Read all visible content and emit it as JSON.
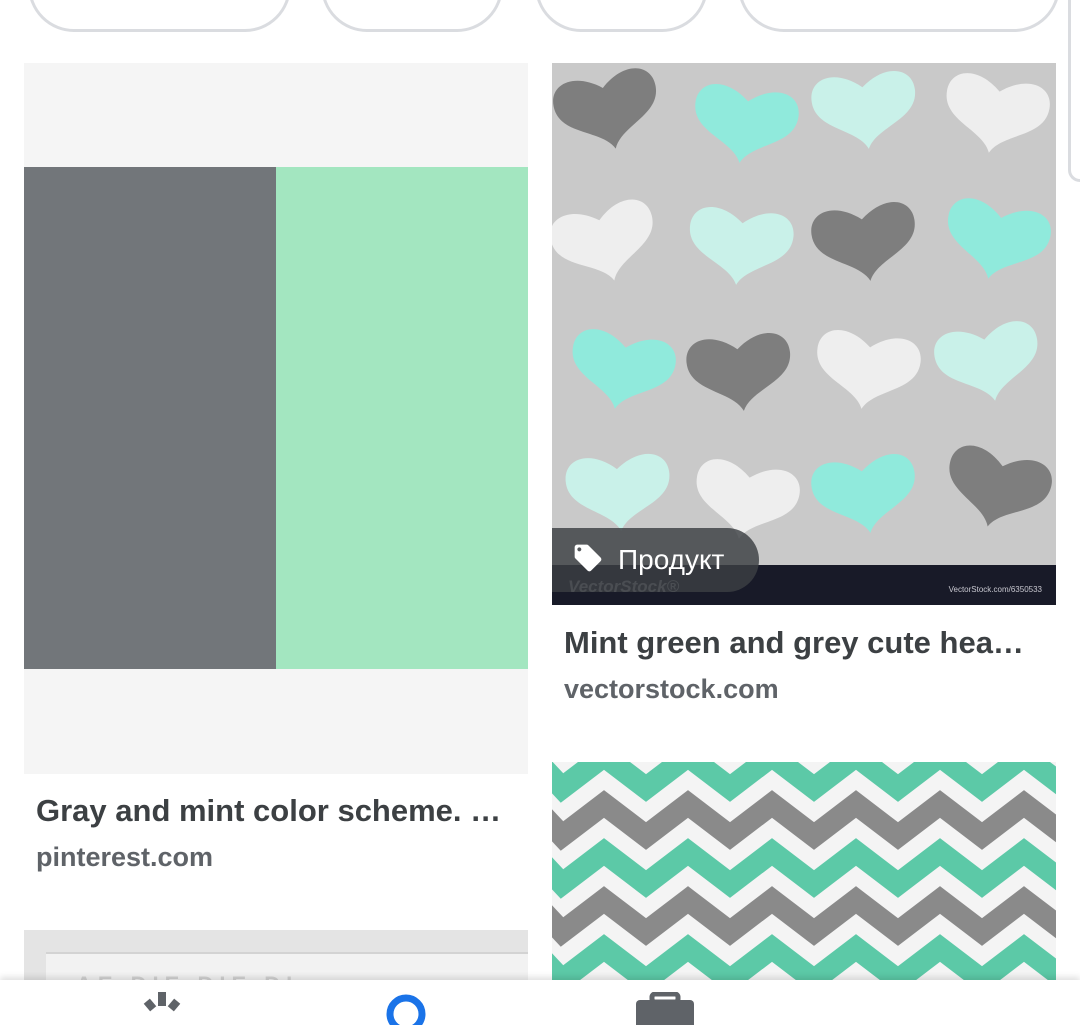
{
  "results": [
    {
      "title": "Gray and mint color scheme. …",
      "source": "pinterest.com",
      "colors": [
        "#72767a",
        "#a3e6c0"
      ]
    },
    {
      "title": "Mint green and grey cute hea…",
      "source": "vectorstock.com",
      "badge": "Продукт",
      "badge_icon": "tag-icon",
      "watermark_left": "VectorStock®",
      "watermark_right": "VectorStock.com/6350533"
    },
    {
      "ghost_text": "AE DIE DIE DI"
    },
    {
      "colors": [
        "#5cc9a7",
        "#8a8a8a",
        "#f4f4f4"
      ]
    }
  ],
  "bottom_nav": {
    "icons": [
      "discover-icon",
      "search-icon",
      "collections-icon"
    ],
    "active_color": "#1a73e8",
    "icon_color": "#5f6368"
  }
}
